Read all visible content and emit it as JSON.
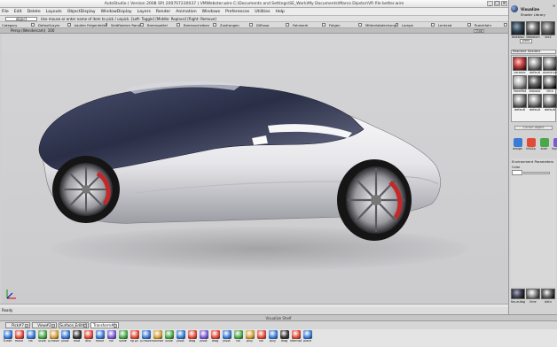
{
  "title": "AutoStudio ( Version 2008 SP) 200707230037 ) VMWebster.wire C:\\Documents and Settings\\SE_Work\\My Documents\\Marco Dipstor\\VR file better.wire",
  "window_controls": [
    "_",
    "□",
    "×"
  ],
  "menubar": [
    "File",
    "Edit",
    "Delete",
    "Layouts",
    "ObjectDisplay",
    "WindowDisplay",
    "Layers",
    "Render",
    "Animation",
    "Windows",
    "Preferences",
    "Utilities",
    "Help"
  ],
  "command": {
    "pick_field": "object",
    "prompt": "Use mouse or enter name of item to pick / unpick. [Left: Toggle] [Middle: Replace] [Right: Remove]"
  },
  "layers": [
    "Category",
    "DefaultLayer",
    "kaufen Felgenteile",
    "Seidflanken Rand",
    "Bremssattel",
    "Bremsscheiben",
    "Zusfrangen",
    "Diffusor",
    "Fahrwerk",
    "Felgen",
    "Mittenlabdeckung",
    "Lampe",
    "Lenkrad",
    "Rueckfahr"
  ],
  "viewport": {
    "title": "Persp (Wendercam)",
    "zoom": "100",
    "show_button": "Show"
  },
  "status": "Ready",
  "shelf": {
    "title": "Visualize Shelf",
    "tabs": [
      "Pick#7",
      "View#2",
      "Surface_Edit#2",
      "Transform#1"
    ],
    "active_tab": 3,
    "tools": [
      {
        "label": "Tr.edit",
        "color": "#3a7bd5"
      },
      {
        "label": "move",
        "color": "#e04b3a"
      },
      {
        "label": "rot",
        "color": "#3a7bd5"
      },
      {
        "label": "scale",
        "color": "#4aa84a"
      },
      {
        "label": "p.move",
        "color": "#d5a13a"
      },
      {
        "label": "pivot",
        "color": "#3a7bd5"
      },
      {
        "label": "mod",
        "color": "#333333"
      },
      {
        "label": "disc",
        "color": "#e04b3a"
      },
      {
        "label": "move",
        "color": "#3a7bd5"
      },
      {
        "label": "rot",
        "color": "#7a5ad5"
      },
      {
        "label": "scale",
        "color": "#4aa84a"
      },
      {
        "label": "np pc",
        "color": "#e04b3a"
      },
      {
        "label": "p.move",
        "color": "#3a7bd5"
      },
      {
        "label": "nonmod",
        "color": "#d5a13a"
      },
      {
        "label": "scale",
        "color": "#4aa84a"
      },
      {
        "label": "pivot",
        "color": "#3a7bd5"
      },
      {
        "label": "drag",
        "color": "#e04b3a"
      },
      {
        "label": "pivot",
        "color": "#7a5ad5"
      },
      {
        "label": "drag",
        "color": "#e04b3a"
      },
      {
        "label": "pivot",
        "color": "#3a7bd5"
      },
      {
        "label": "rot",
        "color": "#4aa84a"
      },
      {
        "label": "pivy",
        "color": "#d5a13a"
      },
      {
        "label": "rot",
        "color": "#e04b3a"
      },
      {
        "label": "pivy",
        "color": "#3a7bd5"
      },
      {
        "label": "drag",
        "color": "#333333"
      },
      {
        "label": "xformpt",
        "color": "#e04b3a"
      },
      {
        "label": "place",
        "color": "#3a7bd5"
      }
    ]
  },
  "right_panel": {
    "title": "Visualize",
    "subtitle": "Shader Library",
    "row1": [
      "diskblau",
      "diskalum",
      "stx2"
    ],
    "glass_button": "glass",
    "section_title": "Resident Shaders",
    "resident": [
      "ceramic",
      "default",
      "aluminium",
      "Steelflat",
      "brosaut",
      "chro",
      "default",
      "default",
      "default",
      "default",
      "default",
      "default"
    ],
    "cursor_btn": "Cursor object",
    "tools": [
      "assign",
      "info2p",
      "scan",
      "layered"
    ],
    "env_title": "Environment Parameters",
    "color_label": "Color",
    "bottom_labels": [
      "fav-autogiroido",
      "lime",
      "dotn"
    ]
  },
  "colors": {
    "accent_red": "#c42828",
    "body_white": "#e8e8ea",
    "glass_blue": "#2e3550"
  }
}
